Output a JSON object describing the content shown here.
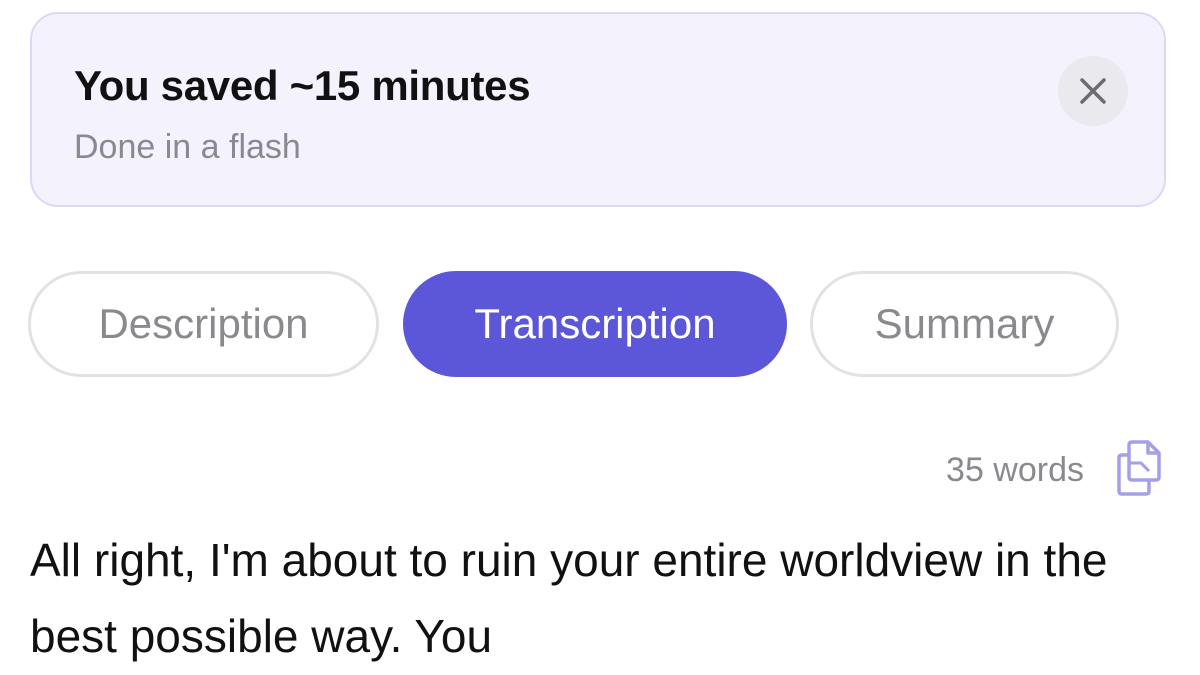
{
  "banner": {
    "title": "You saved ~15 minutes",
    "subtitle": "Done in a flash",
    "close_icon": "close-icon"
  },
  "tabs": [
    {
      "label": "Description",
      "active": false
    },
    {
      "label": "Transcription",
      "active": true
    },
    {
      "label": "Summary",
      "active": false
    }
  ],
  "meta": {
    "word_count": "35 words",
    "copy_icon": "copy-icon"
  },
  "transcript": {
    "text": "All right, I'm about to ruin your entire worldview in the best possible way. You"
  },
  "colors": {
    "accent": "#5b57d8",
    "banner_bg": "#f3f2fd",
    "banner_border": "#dcd9f7",
    "muted_text": "#8a8a8e",
    "copy_icon": "#a3a0e8"
  }
}
